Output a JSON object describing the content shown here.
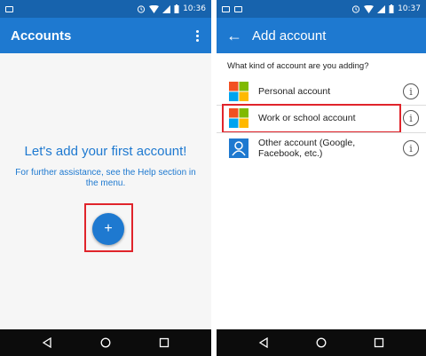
{
  "left_screen": {
    "status_bar": {
      "time": "10:36"
    },
    "app_bar": {
      "title": "Accounts"
    },
    "empty_state": {
      "heading": "Let's add your first account!",
      "help_text": "For further assistance, see the Help section in the menu."
    },
    "fab": {
      "label": "+"
    }
  },
  "right_screen": {
    "status_bar": {
      "time": "10:37"
    },
    "app_bar": {
      "back_label": "←",
      "title": "Add account"
    },
    "question": "What kind of account are you adding?",
    "accounts": [
      {
        "label": "Personal account",
        "logo": "microsoft-logo-icon"
      },
      {
        "label": "Work or school account",
        "logo": "microsoft-logo-icon"
      },
      {
        "label": "Other account (Google, Facebook, etc.)",
        "logo": "person-icon"
      }
    ],
    "info_glyph": "i"
  },
  "colors": {
    "status_bar": "#1763ad",
    "app_bar": "#1e79d0",
    "accent_text": "#1e79d0",
    "highlight": "#e0242b",
    "nav_bar": "#0c0c0c",
    "ms_red": "#f25022",
    "ms_green": "#7fba00",
    "ms_blue": "#00a4ef",
    "ms_yellow": "#ffb900"
  }
}
